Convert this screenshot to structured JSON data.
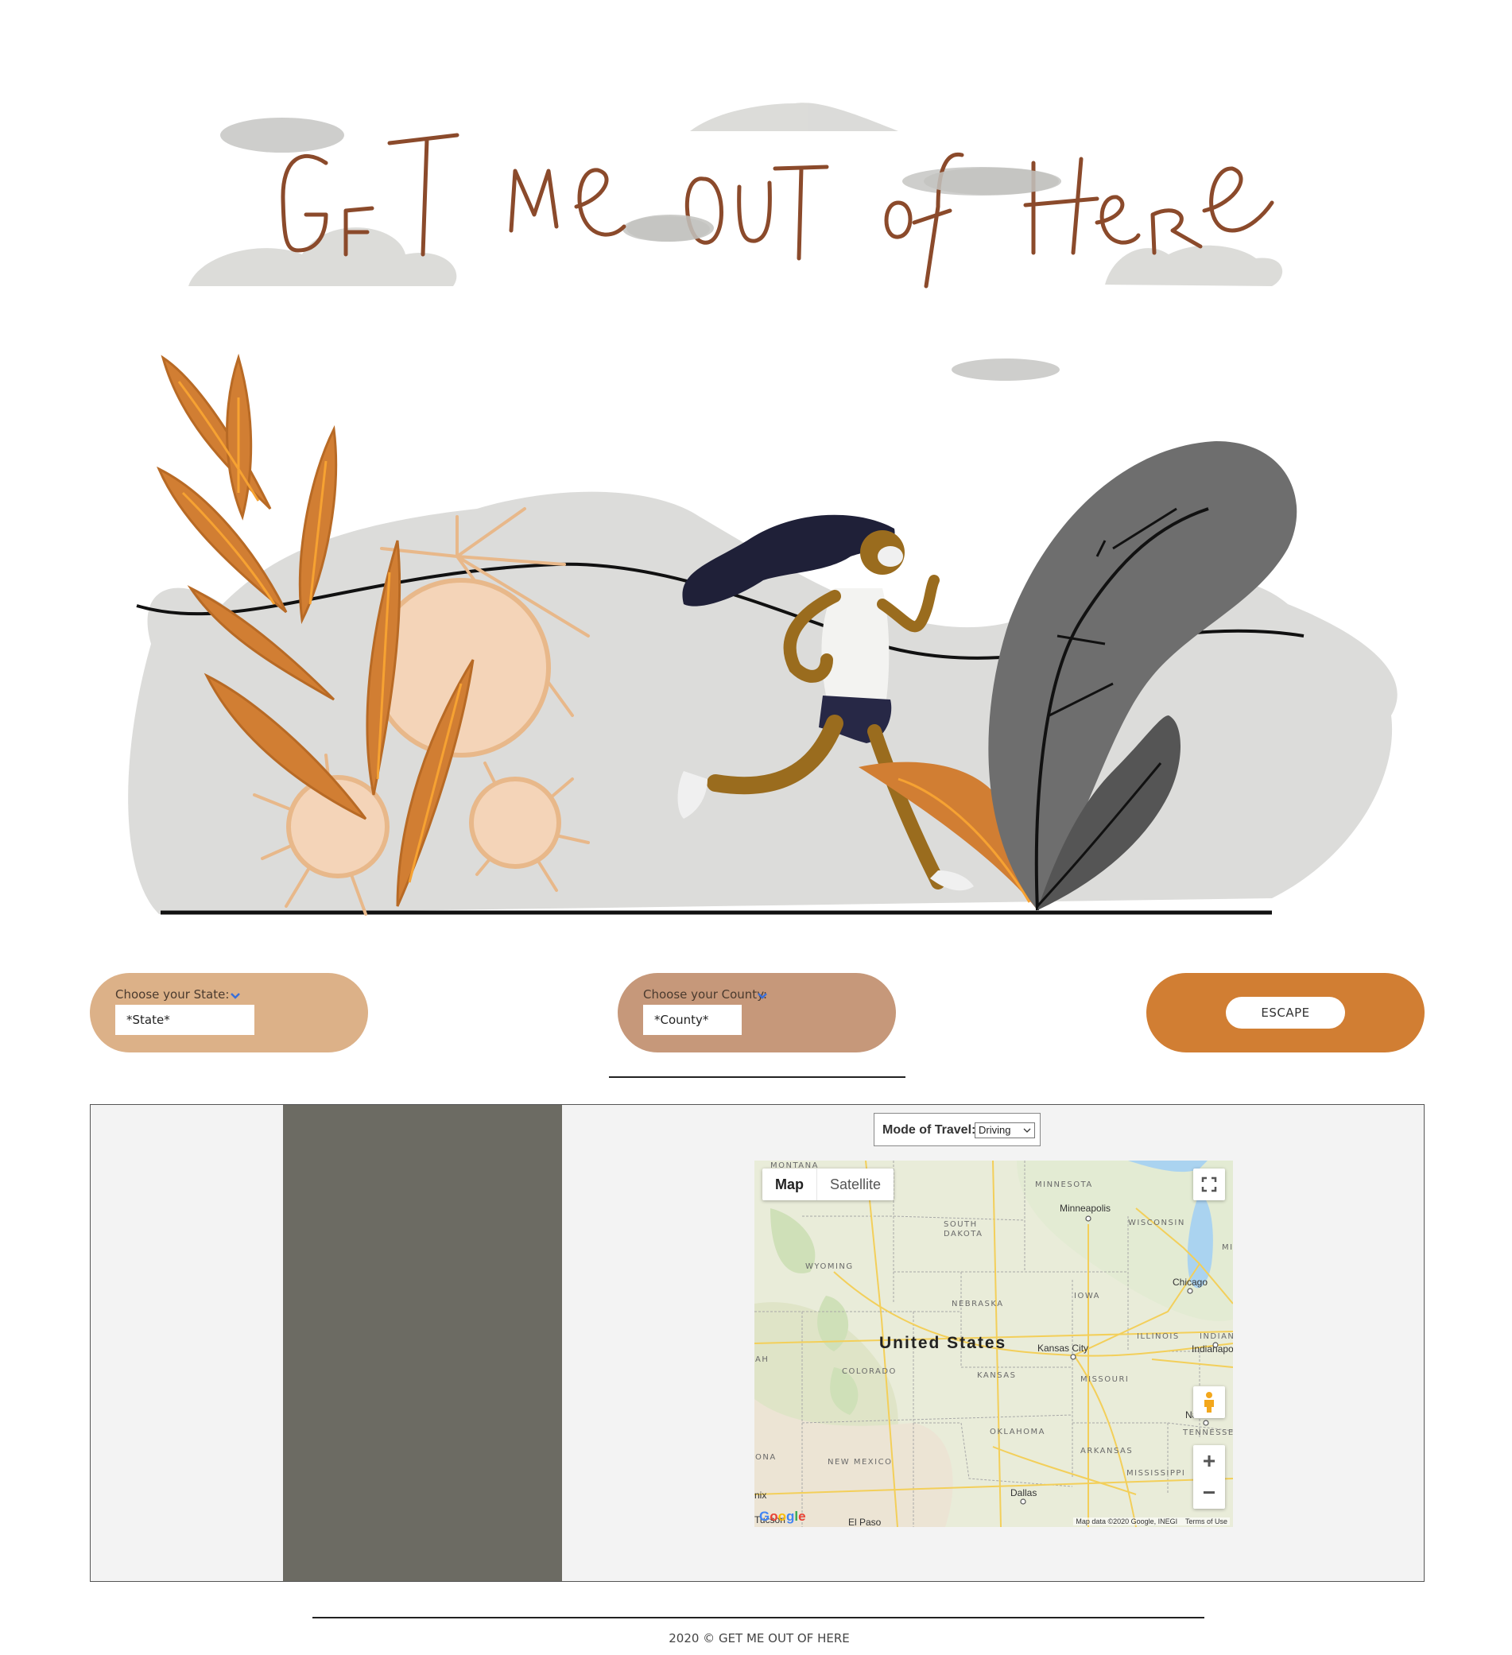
{
  "hero": {
    "title_art": "GET ME OUT OF HERE",
    "image_desc_icon": "running-woman-escaping-virus-illustration"
  },
  "controls": {
    "state": {
      "label": "Choose your State:",
      "value": "*State*"
    },
    "county": {
      "label": "Choose your County:",
      "value": "*County*"
    },
    "escape_label": "ESCAPE"
  },
  "mode": {
    "label": "Mode of Travel:",
    "value": "Driving"
  },
  "map": {
    "type_map": "Map",
    "type_satellite": "Satellite",
    "country": "United States",
    "states": {
      "montana": "MONTANA",
      "minnesota": "MINNESOTA",
      "south_dakota_1": "SOUTH",
      "south_dakota_2": "DAKOTA",
      "wisconsin": "WISCONSIN",
      "mi": "MI",
      "wyoming": "WYOMING",
      "iowa": "IOWA",
      "nebraska": "NEBRASKA",
      "illinois": "ILLINOIS",
      "indiana": "INDIAN",
      "ah": "AH",
      "colorado": "COLORADO",
      "kansas": "KANSAS",
      "missouri": "MISSOURI",
      "tennessee": "TENNESSEE",
      "oklahoma": "OKLAHOMA",
      "arkansas": "ARKANSAS",
      "ona": "ONA",
      "new_mexico": "NEW MEXICO",
      "mississippi": "MISSISSIPPI"
    },
    "cities": {
      "minneapolis": "Minneapolis",
      "chicago": "Chicago",
      "kansas_city": "Kansas City",
      "indianapolis": "Indianapo",
      "nashville": "Nashville",
      "dallas": "Dallas",
      "nix": "nix",
      "tucson": "Tucson",
      "el_paso": "El Paso"
    },
    "google": "Google",
    "attribution": "Map data ©2020 Google, INEGI",
    "terms": "Terms of Use",
    "zoom_in": "+",
    "zoom_out": "−"
  },
  "footer": {
    "text": "2020 © GET ME OUT OF HERE"
  },
  "colors": {
    "state_pill": "#dcb188",
    "county_pill": "#c6987a",
    "escape_pill": "#d17e33",
    "directions_panel": "#6c6b63",
    "title_brown": "#8b4a2b",
    "chevron_blue": "#3a6fd8"
  }
}
